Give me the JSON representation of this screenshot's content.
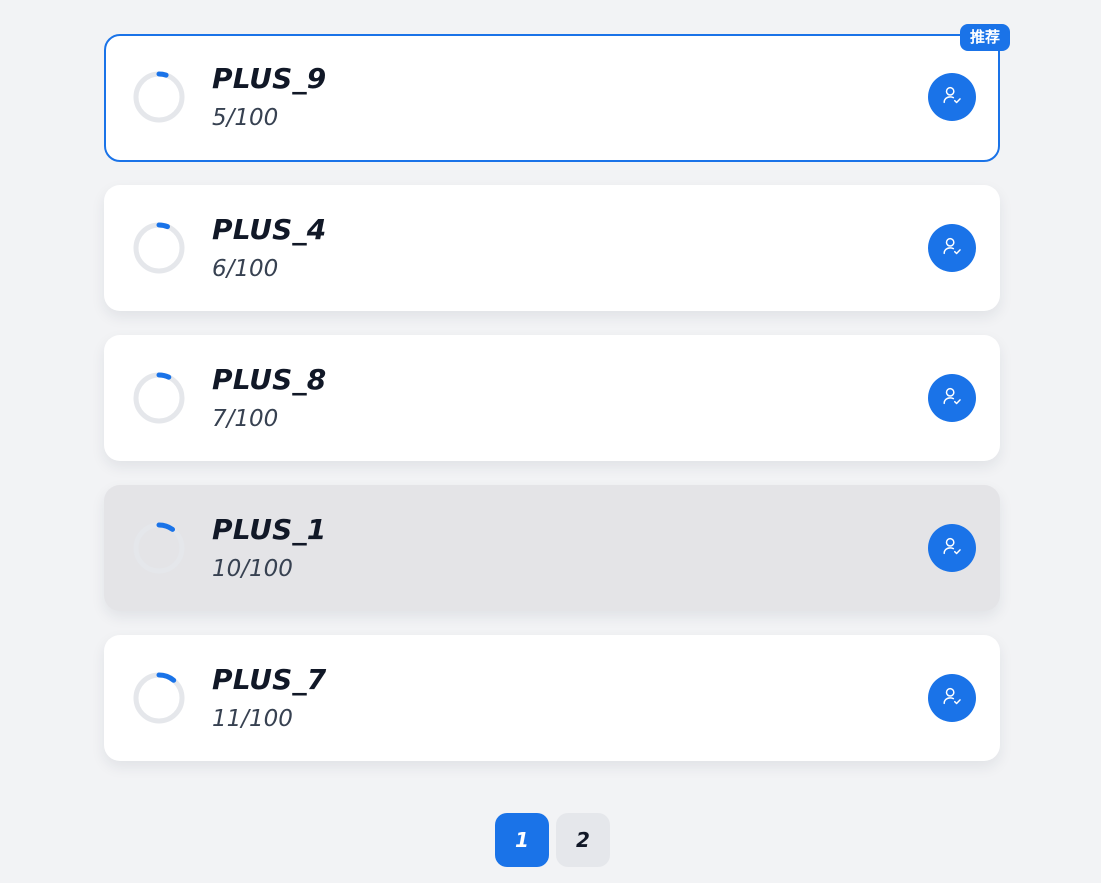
{
  "items": [
    {
      "name": "PLUS_9",
      "count": "5/100",
      "progress": 0.05,
      "selected": true,
      "hover": false,
      "badge": "推荐"
    },
    {
      "name": "PLUS_4",
      "count": "6/100",
      "progress": 0.06,
      "selected": false,
      "hover": false
    },
    {
      "name": "PLUS_8",
      "count": "7/100",
      "progress": 0.07,
      "selected": false,
      "hover": false
    },
    {
      "name": "PLUS_1",
      "count": "10/100",
      "progress": 0.1,
      "selected": false,
      "hover": true
    },
    {
      "name": "PLUS_7",
      "count": "11/100",
      "progress": 0.11,
      "selected": false,
      "hover": false
    }
  ],
  "action_icon": "user-check-icon",
  "pagination": {
    "pages": [
      "1",
      "2"
    ],
    "current": "1"
  },
  "colors": {
    "accent": "#1a73e8",
    "ring_track": "#e5e7eb",
    "background": "#f2f3f5"
  }
}
